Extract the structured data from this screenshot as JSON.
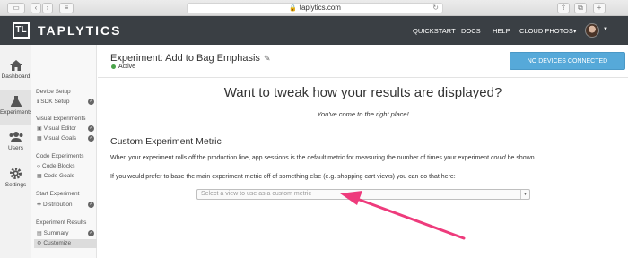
{
  "browser": {
    "url": "taplytics.com"
  },
  "header": {
    "logo_mark": "TL",
    "logo_text": "TAPLYTICS",
    "nav": [
      "QUICKSTART",
      "DOCS",
      "HELP",
      "CLOUD PHOTOS▾"
    ]
  },
  "rail": {
    "items": [
      "Dashboard",
      "Experiments",
      "Users",
      "Settings"
    ]
  },
  "subnav": {
    "device_setup": "Device Setup",
    "sdk_setup": "SDK Setup",
    "visual_experiments": "Visual Experiments",
    "visual_editor": "Visual Editor",
    "visual_goals": "Visual Goals",
    "code_experiments": "Code Experiments",
    "code_blocks": "Code Blocks",
    "code_goals": "Code Goals",
    "start_experiment": "Start Experiment",
    "distribution": "Distribution",
    "experiment_results": "Experiment Results",
    "summary": "Summary",
    "customize": "Customize"
  },
  "main": {
    "title": "Experiment: Add to Bag Emphasis",
    "status": "Active",
    "devices_button": "NO DEVICES CONNECTED",
    "headline": "Want to tweak how your results are displayed?",
    "subhead": "You've come to the right place!",
    "section_title": "Custom Experiment Metric",
    "para1_a": "When your experiment rolls off the production line, app sessions is the default metric for measuring the number of times your experiment ",
    "para1_em": "could",
    "para1_b": " be shown.",
    "para2": "If you would prefer to base the main experiment metric off of something else (e.g. shopping cart views) you can do that here:",
    "select_placeholder": "Select a view to use as a custom metric"
  },
  "colors": {
    "header_bg": "#3a3f44",
    "button_blue": "#56a9d9",
    "status_green": "#4aa34a",
    "annotation_arrow": "#ee3b7c"
  }
}
